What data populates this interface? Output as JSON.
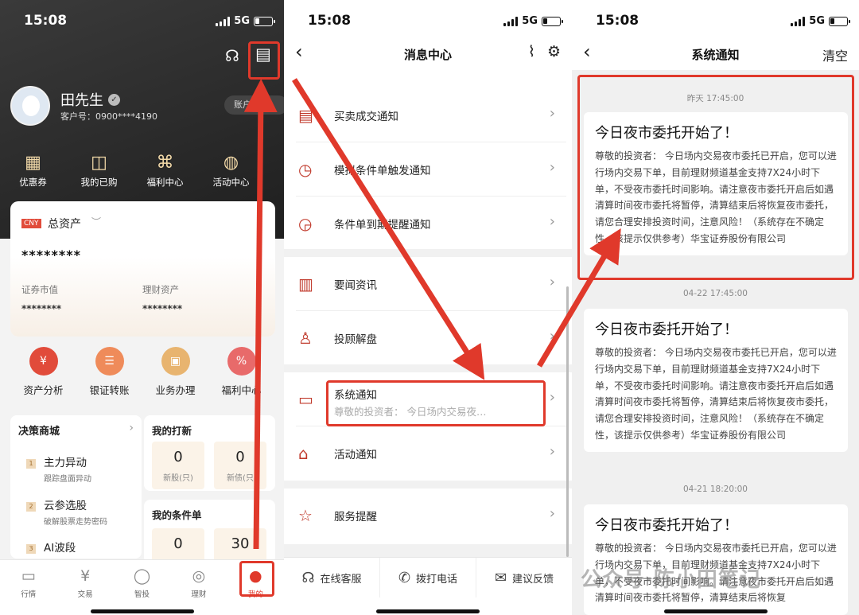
{
  "status": {
    "time": "15:08",
    "network": "5G"
  },
  "panel1": {
    "user": {
      "name": "田先生",
      "customer_no": "客户号：0900****4190",
      "account_btn": "账户信"
    },
    "quick": [
      {
        "icon": "coupon-icon",
        "glyph": "▦",
        "label": "优惠券"
      },
      {
        "icon": "bag-icon",
        "glyph": "◫",
        "label": "我的已购"
      },
      {
        "icon": "gift-icon",
        "glyph": "⌘",
        "label": "福利中心"
      },
      {
        "icon": "planet-icon",
        "glyph": "◍",
        "label": "活动中心"
      }
    ],
    "asset": {
      "badge": "CNY",
      "title": "总资产",
      "total": "********",
      "sec_label": "证券市值",
      "sec_value": "********",
      "fin_label": "理财资产",
      "fin_value": "********"
    },
    "services": [
      {
        "label": "资产分析",
        "color": "#e14b3a",
        "glyph": "¥"
      },
      {
        "label": "银证转账",
        "color": "#ef8b5a",
        "glyph": "☰"
      },
      {
        "label": "业务办理",
        "color": "#e8b46f",
        "glyph": "▣"
      },
      {
        "label": "福利中心",
        "color": "#e86a6a",
        "glyph": "%"
      }
    ],
    "decision": {
      "title": "决策商城",
      "items": [
        {
          "num": "1",
          "title": "主力异动",
          "sub": "跟踪盘面异动"
        },
        {
          "num": "2",
          "title": "云参选股",
          "sub": "破解股票走势密码"
        },
        {
          "num": "3",
          "title": "AI波段",
          "sub": ""
        }
      ]
    },
    "dabox": {
      "title": "我的打新",
      "cells": [
        {
          "num": "0",
          "label": "新股(只)"
        },
        {
          "num": "0",
          "label": "新债(只"
        }
      ]
    },
    "cdbox": {
      "title": "我的条件单",
      "cells": [
        {
          "num": "0"
        },
        {
          "num": "30"
        }
      ]
    },
    "tabs": [
      {
        "label": "行情",
        "glyph": "▭"
      },
      {
        "label": "交易",
        "glyph": "¥"
      },
      {
        "label": "智投",
        "glyph": "◯"
      },
      {
        "label": "理财",
        "glyph": "◎"
      },
      {
        "label": "我的",
        "glyph": "●"
      }
    ]
  },
  "panel2": {
    "title": "消息中心",
    "rows1": [
      {
        "icon": "trade-icon",
        "glyph": "▤",
        "label": "买卖成交通知"
      },
      {
        "icon": "condition-icon",
        "glyph": "◷",
        "label": "模拟条件单触发通知"
      },
      {
        "icon": "alarm-icon",
        "glyph": "◶",
        "label": "条件单到期提醒通知"
      }
    ],
    "rows2": [
      {
        "icon": "news-icon",
        "glyph": "▥",
        "label": "要闻资讯"
      },
      {
        "icon": "advisor-icon",
        "glyph": "♙",
        "label": "投顾解盘"
      }
    ],
    "rows3": [
      {
        "icon": "monitor-icon",
        "glyph": "▭",
        "label": "系统通知",
        "sub": "尊敬的投资者：  今日场内交易夜…"
      },
      {
        "icon": "gift-box-icon",
        "glyph": "⌂",
        "label": "活动通知"
      }
    ],
    "rows4": [
      {
        "icon": "star-icon",
        "glyph": "☆",
        "label": "服务提醒"
      }
    ],
    "footer": [
      {
        "icon": "headset-icon",
        "glyph": "☊",
        "label": "在线客服"
      },
      {
        "icon": "phone-icon",
        "glyph": "✆",
        "label": "拨打电话"
      },
      {
        "icon": "mail-icon",
        "glyph": "✉",
        "label": "建议反馈"
      }
    ]
  },
  "panel3": {
    "title": "系统通知",
    "clear": "清空",
    "notices": [
      {
        "time": "昨天 17:45:00",
        "title": "今日夜市委托开始了！",
        "body": "尊敬的投资者：  今日场内交易夜市委托已开启，您可以进行场内交易下单，目前理财频道基金支持7X24小时下单，不受夜市委托时间影响。请注意夜市委托开启后如遇清算时间夜市委托将暂停，清算结束后将恢复夜市委托，请您合理安排投资时间，注意风险！（系统存在不确定性，该提示仅供参考）华宝证券股份有限公司"
      },
      {
        "time": "04-22 17:45:00",
        "title": "今日夜市委托开始了！",
        "body": "尊敬的投资者：  今日场内交易夜市委托已开启，您可以进行场内交易下单，目前理财频道基金支持7X24小时下单，不受夜市委托时间影响。请注意夜市委托开启后如遇清算时间夜市委托将暂停，清算结束后将恢复夜市委托，请您合理安排投资时间，注意风险！（系统存在不确定性，该提示仅供参考）华宝证券股份有限公司"
      },
      {
        "time": "04-21 18:20:00",
        "title": "今日夜市委托开始了！",
        "body": "尊敬的投资者：  今日场内交易夜市委托已开启，您可以进行场内交易下单，目前理财频道基金支持7X24小时下单，不受夜市委托时间影响。请注意夜市委托开启后如遇清算时间夜市委托将暂停，清算结束后将恢复"
      }
    ]
  },
  "watermark": "公众号·陈小田笔记",
  "colors": {
    "accent": "#e0392b",
    "dark": "#2a2a2a"
  }
}
